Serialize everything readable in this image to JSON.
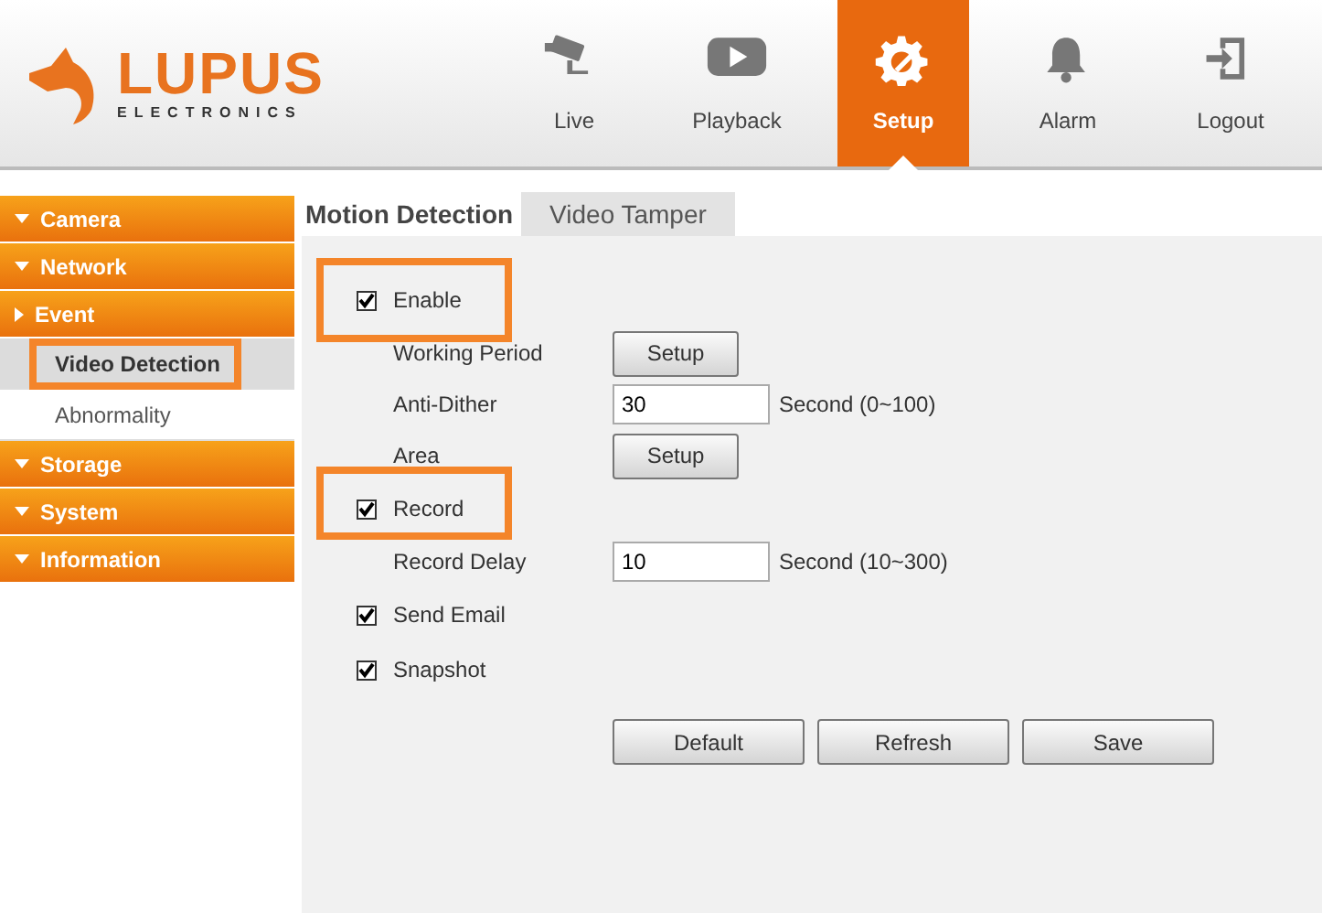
{
  "logo": {
    "name": "LUPUS",
    "tagline": "ELECTRONICS"
  },
  "nav": [
    {
      "label": "Live",
      "selected": false
    },
    {
      "label": "Playback",
      "selected": false
    },
    {
      "label": "Setup",
      "selected": true
    },
    {
      "label": "Alarm",
      "selected": false
    },
    {
      "label": "Logout",
      "selected": false
    }
  ],
  "sidebar": [
    {
      "label": "Camera",
      "kind": "group",
      "expanded": true
    },
    {
      "label": "Network",
      "kind": "group",
      "expanded": true
    },
    {
      "label": "Event",
      "kind": "group",
      "expanded": false
    },
    {
      "label": "Video Detection",
      "kind": "subitem",
      "selected": true,
      "highlighted": true
    },
    {
      "label": "Abnormality",
      "kind": "subitem",
      "selected": false,
      "highlighted": false
    },
    {
      "label": "Storage",
      "kind": "group",
      "expanded": true
    },
    {
      "label": "System",
      "kind": "group",
      "expanded": true
    },
    {
      "label": "Information",
      "kind": "group",
      "expanded": true
    }
  ],
  "tabs": [
    {
      "label": "Motion Detection",
      "selected": true
    },
    {
      "label": "Video Tamper",
      "selected": false
    }
  ],
  "rows": [
    {
      "kind": "checkbox",
      "label": "Enable",
      "checked": true,
      "highlighted": true
    },
    {
      "kind": "button",
      "label": "Working Period",
      "button": "Setup"
    },
    {
      "kind": "input",
      "label": "Anti-Dither",
      "value": "30",
      "hint": "Second (0~100)"
    },
    {
      "kind": "button",
      "label": "Area",
      "button": "Setup"
    },
    {
      "kind": "checkbox",
      "label": "Record",
      "checked": true,
      "highlighted": true
    },
    {
      "kind": "input",
      "label": "Record Delay",
      "value": "10",
      "hint": "Second (10~300)"
    },
    {
      "kind": "checkbox",
      "label": "Send Email",
      "checked": true,
      "highlighted": false
    },
    {
      "kind": "checkbox",
      "label": "Snapshot",
      "checked": true,
      "highlighted": false
    }
  ],
  "buttons": [
    "Default",
    "Refresh",
    "Save"
  ]
}
